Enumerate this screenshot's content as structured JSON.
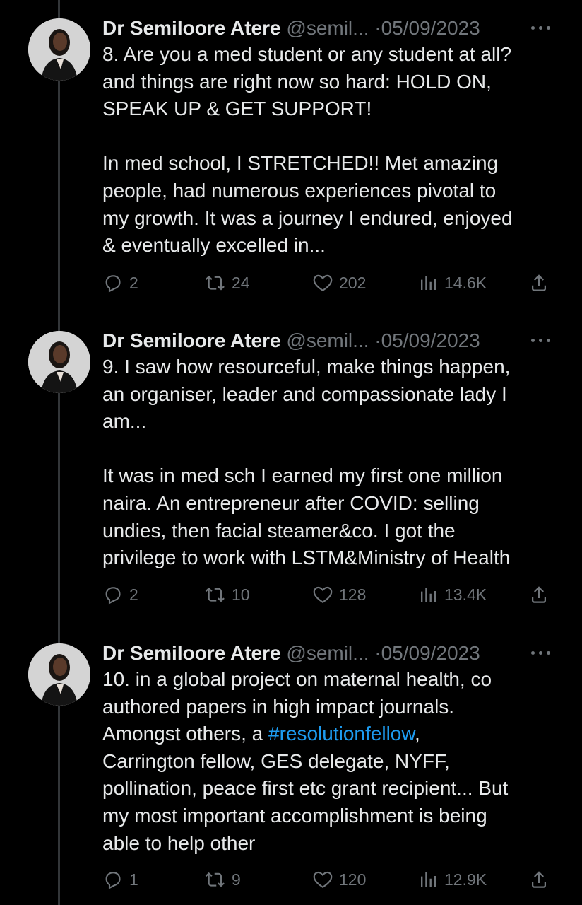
{
  "tweets": [
    {
      "author_name": "Dr Semiloore Atere",
      "handle": "@semil...",
      "separator": "·",
      "date": "05/09/2023",
      "lines": [
        "8. Are you a med student or any student at all?",
        "and things are right now so hard: HOLD ON,",
        "SPEAK UP & GET SUPPORT!",
        "",
        "In med school, I STRETCHED!! Met amazing",
        "people, had numerous experiences pivotal to",
        "my growth. It was a journey I endured, enjoyed",
        "& eventually excelled in..."
      ],
      "replies": "2",
      "retweets": "24",
      "likes": "202",
      "views": "14.6K"
    },
    {
      "author_name": "Dr Semiloore Atere",
      "handle": "@semil...",
      "separator": "·",
      "date": "05/09/2023",
      "lines": [
        "9. I saw how resourceful, make things happen,",
        "an organiser, leader and compassionate lady I",
        "am...",
        "",
        "It was in med sch I earned my first one million",
        "naira. An entrepreneur after COVID: selling",
        "undies, then facial steamer&co. I got the",
        "privilege to work with LSTM&Ministry of Health"
      ],
      "replies": "2",
      "retweets": "10",
      "likes": "128",
      "views": "13.4K"
    },
    {
      "author_name": "Dr Semiloore Atere",
      "handle": "@semil...",
      "separator": "·",
      "date": "05/09/2023",
      "lines": [
        "10. in a global project on maternal health, co",
        "authored papers in high impact journals.",
        "Amongst others, a ",
        "Carrington fellow, GES delegate, NYFF,",
        "pollination, peace first etc grant recipient... But",
        "my most important accomplishment is being",
        "able to help other"
      ],
      "hashtag": "#resolutionfellow",
      "hashtag_suffix": ",",
      "replies": "1",
      "retweets": "9",
      "likes": "120",
      "views": "12.9K"
    }
  ],
  "icons": {
    "reply": "reply-icon",
    "retweet": "retweet-icon",
    "like": "heart-icon",
    "views": "views-icon",
    "share": "share-icon",
    "more": "more-dots-icon"
  },
  "colors": {
    "background": "#000000",
    "text": "#e7e9ea",
    "muted": "#71767b",
    "link": "#1d9bf0",
    "thread_line": "#333639"
  }
}
